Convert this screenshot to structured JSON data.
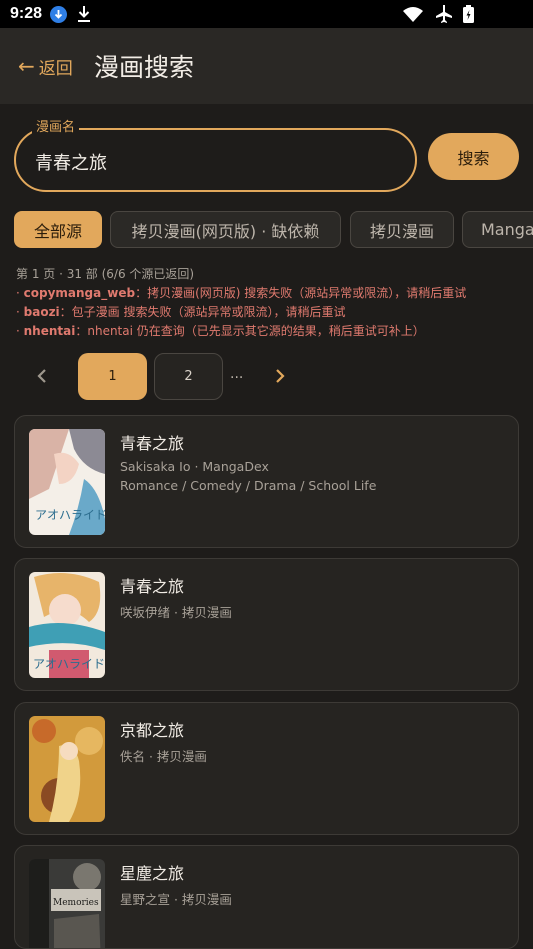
{
  "status_bar": {
    "time": "9:28"
  },
  "header": {
    "back_label": "返回",
    "title": "漫画搜索"
  },
  "search": {
    "legend": "漫画名",
    "value": "青春之旅",
    "button_label": "搜索"
  },
  "source_chips": [
    {
      "label": "全部源",
      "selected": true
    },
    {
      "label": "拷贝漫画(网页版) · 缺依赖",
      "selected": false
    },
    {
      "label": "拷贝漫画",
      "selected": false
    },
    {
      "label": "MangaDex",
      "selected": false
    }
  ],
  "results_info": {
    "summary": "第 1 页 · 31 部 (6/6 个源已返回)",
    "errors": [
      {
        "source": "copymanga_web",
        "message": "：拷贝漫画(网页版) 搜索失败（源站异常或限流），请稍后重试"
      },
      {
        "source": "baozi",
        "message": "：包子漫画 搜索失败（源站异常或限流），请稍后重试"
      },
      {
        "source": "nhentai",
        "message": "：nhentai 仍在查询（已先显示其它源的结果，稍后重试可补上）"
      }
    ]
  },
  "pagination": {
    "current": "1",
    "next": "2",
    "ellipsis": "..."
  },
  "results": [
    {
      "title": "青春之旅",
      "meta": "Sakisaka Io · MangaDex",
      "tags": "Romance / Comedy / Drama / School Life",
      "cover_colors": [
        "#f4efe8",
        "#d9b3a6",
        "#6aa9c9",
        "#2d6e8f"
      ]
    },
    {
      "title": "青春之旅",
      "meta": "咲坂伊绪 · 拷贝漫画",
      "tags": "",
      "cover_colors": [
        "#f2e9dd",
        "#e7b46a",
        "#3f9fb5",
        "#d15a6f"
      ]
    },
    {
      "title": "京都之旅",
      "meta": "佚名 · 拷贝漫画",
      "tags": "",
      "cover_colors": [
        "#d29a3c",
        "#c76a2a",
        "#8a4a23",
        "#f0d38a"
      ]
    },
    {
      "title": "星塵之旅",
      "meta": "星野之宣 · 拷贝漫画",
      "tags": "",
      "cover_colors": [
        "#3a3a38",
        "#7a776f",
        "#c9c4ba",
        "#1d1d1b"
      ]
    }
  ],
  "colors": {
    "accent": "#e2a85c",
    "background": "#1e1c1a",
    "card": "#262421",
    "error": "#e07a6f"
  }
}
